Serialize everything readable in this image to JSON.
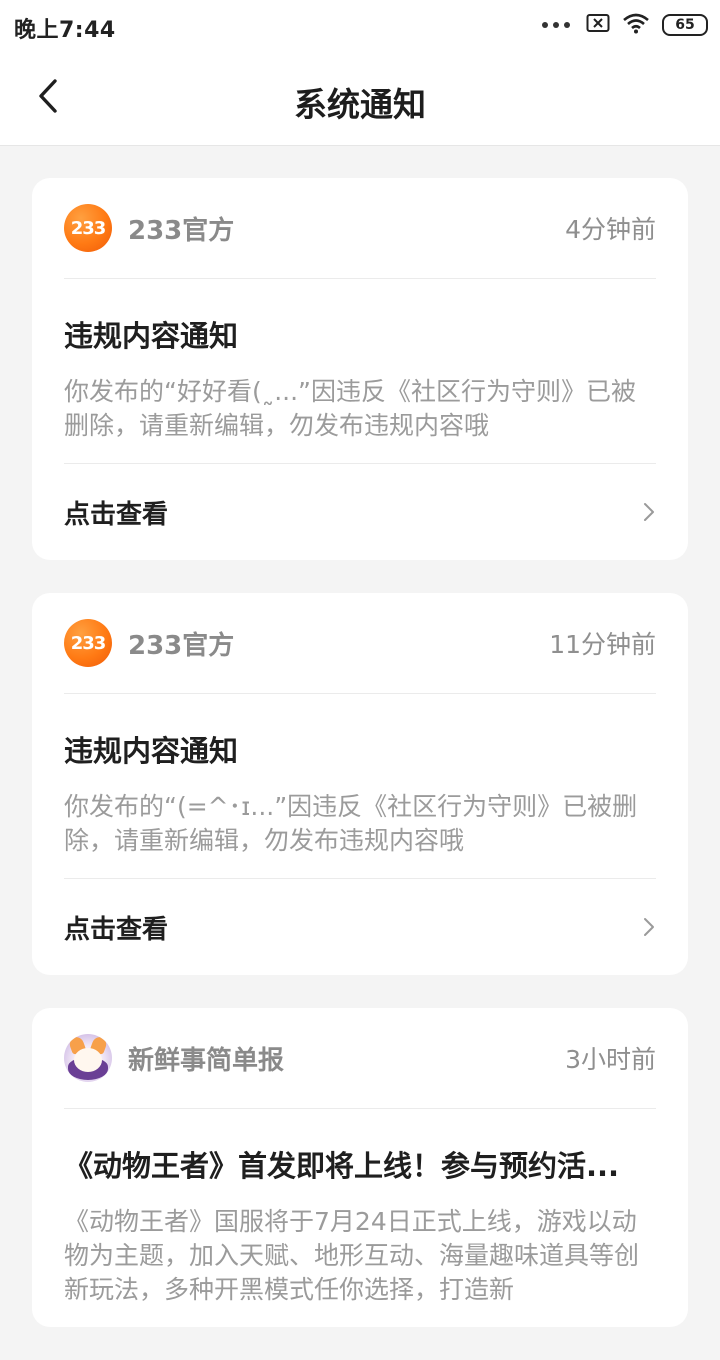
{
  "status_bar": {
    "time": "晚上7:44",
    "battery": "65"
  },
  "header": {
    "title": "系统通知"
  },
  "notifications": [
    {
      "sender": "233官方",
      "avatar_text": "233",
      "time": "4分钟前",
      "title": "违规内容通知",
      "body": "你发布的“好好看(˷...”因违反《社区行为守则》已被删除，请重新编辑，勿发布违规内容哦",
      "action": "点击查看"
    },
    {
      "sender": "233官方",
      "avatar_text": "233",
      "time": "11分钟前",
      "title": "违规内容通知",
      "body": "你发布的“(=^･ɪ...”因违反《社区行为守则》已被删除，请重新编辑，勿发布违规内容哦",
      "action": "点击查看"
    },
    {
      "sender": "新鲜事简单报",
      "time": "3小时前",
      "title": "《动物王者》首发即将上线！参与预约活...",
      "body": "《动物王者》国服将于7月24日正式上线，游戏以动物为主题，加入天赋、地形互动、海量趣味道具等创新玩法，多种开黑模式任你选择，打造新"
    }
  ],
  "colors": {
    "brand_orange": "#ff7a14",
    "background": "#f4f4f4",
    "card": "#ffffff",
    "muted_text": "#9b9b9b"
  }
}
